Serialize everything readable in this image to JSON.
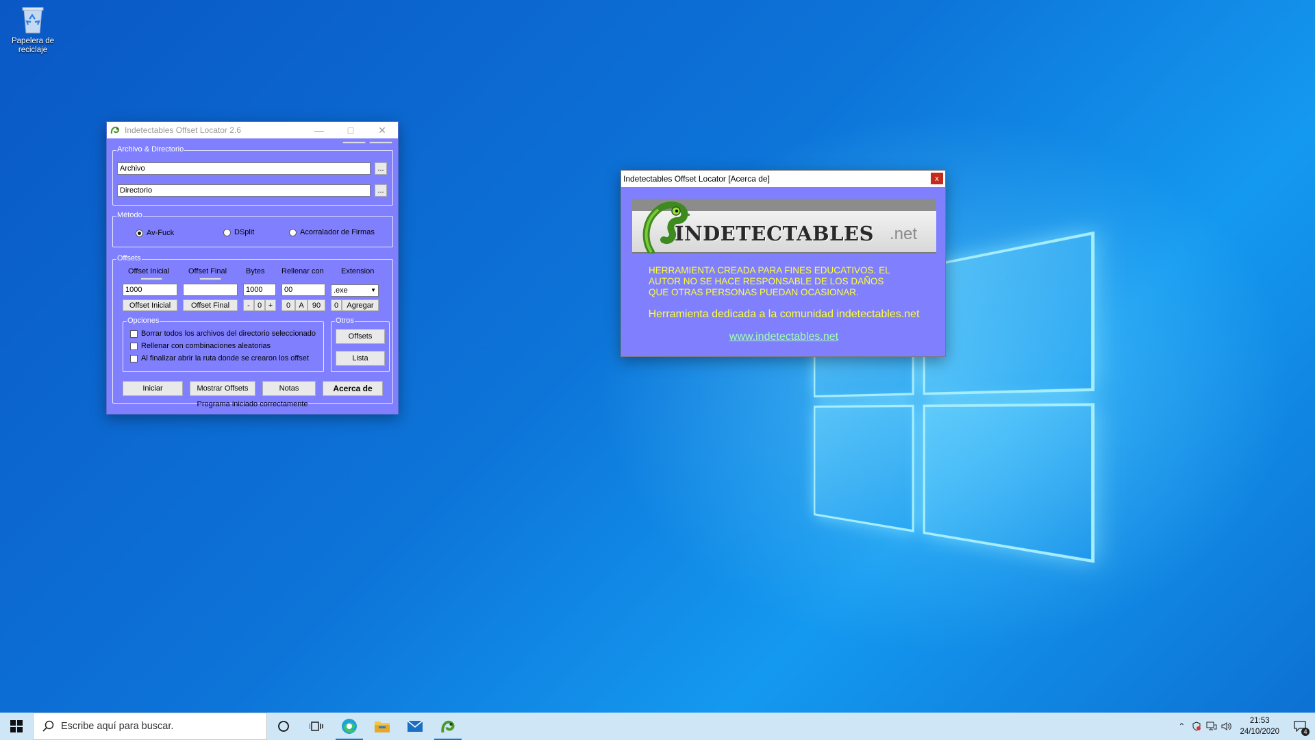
{
  "desktop": {
    "recycle_bin_label": "Papelera de reciclaje"
  },
  "main_window": {
    "title": "Indetectables Offset Locator 2.6",
    "file_group": {
      "label": "Archivo & Directorio",
      "file_value": "Archivo",
      "dir_value": "Directorio",
      "browse_label": "..."
    },
    "method_group": {
      "label": "Método",
      "options": [
        "Av-Fuck",
        "DSplit",
        "Acorralador de Firmas"
      ],
      "selected": "Av-Fuck"
    },
    "offsets_group": {
      "label": "Offsets",
      "columns": [
        "Offset Inicial",
        "Offset Final",
        "Bytes",
        "Rellenar con",
        "Extension"
      ],
      "offset_inicial_value": "1000",
      "offset_final_value": "",
      "bytes_value": "1000",
      "rellenar_value": "00",
      "extension_value": ".exe",
      "btn_offset_inicial": "Offset Inicial",
      "btn_offset_final": "Offset Final",
      "btn_minus": "-",
      "btn_zero": "0",
      "btn_plus": "+",
      "btn_fill_0": "0",
      "btn_fill_a": "A",
      "btn_fill_90": "90",
      "btn_ext_0": "0",
      "btn_agregar": "Agregar"
    },
    "options_group": {
      "label": "Opciones",
      "items": [
        "Borrar todos los archivos del directorio seleccionado",
        "Rellenar con combinaciones aleatorias",
        "Al finalizar abrir la ruta donde se crearon los offset"
      ]
    },
    "otros_group": {
      "label": "Otros",
      "btn_offsets": "Offsets",
      "btn_lista": "Lista"
    },
    "buttons": {
      "iniciar": "Iniciar",
      "mostrar_offsets": "Mostrar Offsets",
      "notas": "Notas",
      "acerca_de": "Acerca de"
    },
    "status": "Programa iniciado correctamente"
  },
  "about_window": {
    "title": "Indetectables Offset Locator [Acerca de]",
    "close_label": "x",
    "banner_text": "INDETECTABLES",
    "banner_suffix": ".net",
    "warning_lines": [
      "HERRAMIENTA CREADA PARA FINES EDUCATIVOS. EL",
      "AUTOR NO SE HACE RESPONSABLE DE LOS DAÑOS",
      "QUE OTRAS PERSONAS PUEDAN OCASIONAR."
    ],
    "dedication": "Herramienta dedicada  a la comunidad indetectables.net",
    "link": "www.indetectables.net",
    "text_color": "#ffff33",
    "link_color": "#a0ffb0",
    "background_color": "#8080ff"
  },
  "taskbar": {
    "search_placeholder": "Escribe aquí para buscar.",
    "time": "21:53",
    "date": "24/10/2020",
    "notification_count": "4"
  }
}
